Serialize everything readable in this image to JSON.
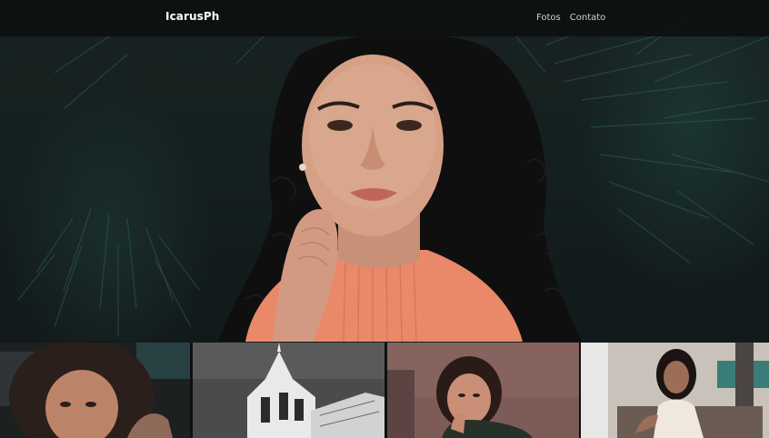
{
  "nav": {
    "brand": "IcarusPh",
    "links": [
      {
        "label": "Fotos"
      },
      {
        "label": "Contato"
      }
    ]
  },
  "colors": {
    "nav_background": "#0e1011",
    "hero_background": "#142020",
    "accent_foliage": "#2c5f57",
    "top_color": "#e9896a"
  },
  "hero": {
    "image": "portrait-curly-hair-woman"
  },
  "gallery": {
    "photos": [
      {
        "image": "curly-hair-woman-closeup"
      },
      {
        "image": "church-tower-black-and-white"
      },
      {
        "image": "woman-resting-chin-on-hand"
      },
      {
        "image": "woman-sitting-indoors"
      }
    ]
  }
}
